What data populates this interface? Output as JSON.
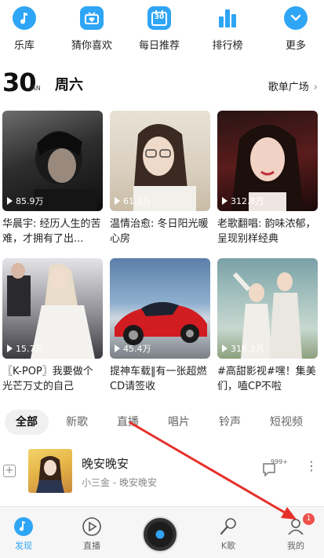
{
  "quicknav": [
    {
      "label": "乐库",
      "icon": "music-note-icon"
    },
    {
      "label": "猜你喜欢",
      "icon": "heart-radio-icon"
    },
    {
      "label": "每日推荐",
      "icon": "calendar-icon"
    },
    {
      "label": "排行榜",
      "icon": "bar-chart-icon"
    },
    {
      "label": "更多",
      "icon": "chevron-down-icon"
    }
  ],
  "calendar_icon_text": "30",
  "date": {
    "day": "30",
    "month": "JAN",
    "weekday": "周六"
  },
  "plaza": {
    "label": "歌单广场",
    "chevron": "›"
  },
  "playlists": [
    {
      "plays": "85.9万",
      "title": "华晨宇: 经历人生的苦难，才拥有了出..."
    },
    {
      "plays": "61.2万",
      "title": "温情治愈: 冬日阳光暖心房"
    },
    {
      "plays": "312.8万",
      "title": "老歌翻唱: 韵味浓郁，呈现别样经典"
    },
    {
      "plays": "15.7万",
      "title": "〖K-POP〗我要做个光芒万丈的自己"
    },
    {
      "plays": "45.4万",
      "title": "提神车载‖有一张超燃CD请签收"
    },
    {
      "plays": "318.2万",
      "title": "#高甜影视#嘿！集美们，嗑CP不啦"
    }
  ],
  "tabs": [
    "全部",
    "新歌",
    "直播",
    "唱片",
    "铃声",
    "短视频"
  ],
  "song": {
    "title": "晚安晚安",
    "meta": "小三金 - 晚安晚安",
    "comment_count": "999+",
    "add_icon": "+",
    "more_icon": "⋮"
  },
  "bottombar": [
    {
      "label": "发现",
      "icon": "discover-icon"
    },
    {
      "label": "直播",
      "icon": "live-play-icon"
    },
    {
      "label": "",
      "icon": "player-disc-icon"
    },
    {
      "label": "K歌",
      "icon": "microphone-icon"
    },
    {
      "label": "我的",
      "icon": "profile-icon"
    }
  ],
  "badge_count": "1",
  "colors": {
    "accent": "#2fa5f5",
    "badge": "#f0504a",
    "arrow": "#e5302a"
  }
}
